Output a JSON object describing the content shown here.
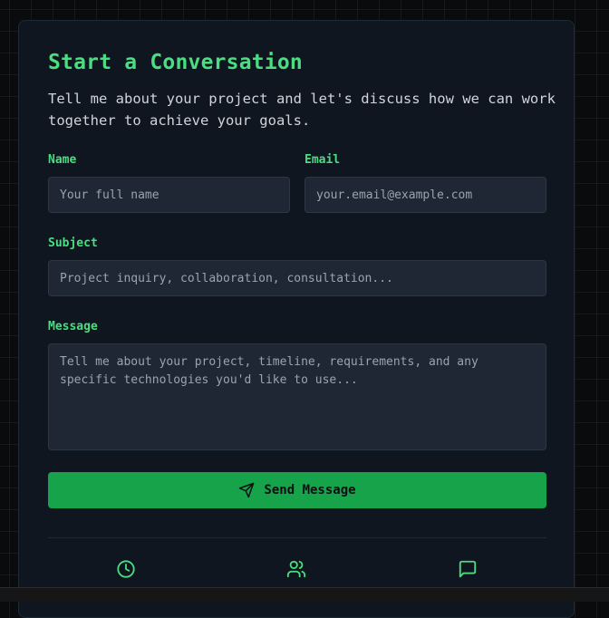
{
  "form": {
    "title": "Start a Conversation",
    "subtitle": "Tell me about your project and let's discuss how we can work together to achieve your goals.",
    "name": {
      "label": "Name",
      "placeholder": "Your full name",
      "value": ""
    },
    "email": {
      "label": "Email",
      "placeholder": "your.email@example.com",
      "value": ""
    },
    "subject": {
      "label": "Subject",
      "placeholder": "Project inquiry, collaboration, consultation...",
      "value": ""
    },
    "message": {
      "label": "Message",
      "placeholder": "Tell me about your project, timeline, requirements, and any specific technologies you'd like to use...",
      "value": ""
    },
    "send_label": "Send Message",
    "send_icon": "send-icon"
  },
  "footer": {
    "icons": [
      "clock-icon",
      "users-icon",
      "message-square-icon"
    ]
  },
  "colors": {
    "accent": "#4ade80",
    "button": "#16a34a",
    "card_bg": "#0f1620",
    "input_bg": "#1e2733",
    "page_bg": "#0a0b0c"
  }
}
